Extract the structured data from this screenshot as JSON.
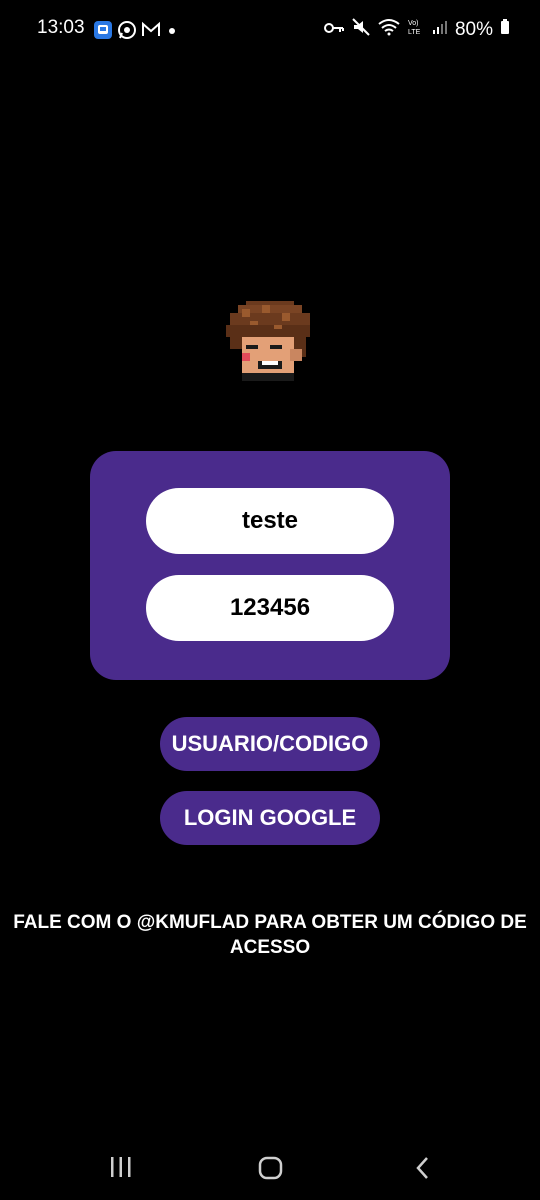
{
  "status_bar": {
    "time": "13:03",
    "battery": "80%",
    "left_icons": [
      "app-notification-icon",
      "whatsapp-icon",
      "gmail-icon",
      "dot-icon"
    ],
    "right_icons": [
      "vpn-key-icon",
      "mute-icon",
      "wifi-icon",
      "volte-icon",
      "signal-icon",
      "battery-icon"
    ]
  },
  "login": {
    "username_value": "teste",
    "code_value": "123456"
  },
  "buttons": {
    "user_code": "USUARIO/CODIGO",
    "google": "LOGIN GOOGLE"
  },
  "info": {
    "line1": "FALE COM O @KMUFLAD PARA OBTER UM CÓDIGO DE",
    "line2": "ACESSO"
  },
  "colors": {
    "background": "#000000",
    "accent": "#4a2b8c",
    "field": "#ffffff"
  },
  "nav_icons": [
    "recent-apps-icon",
    "home-icon",
    "back-icon"
  ]
}
